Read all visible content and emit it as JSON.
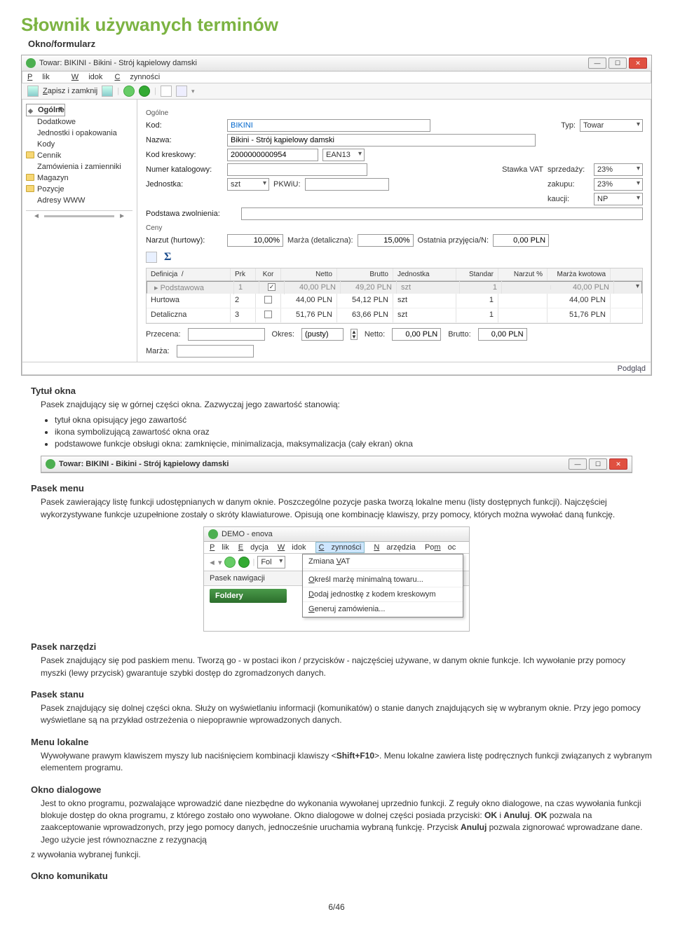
{
  "heading": "Słownik używanych terminów",
  "section_okno": "Okno/formularz",
  "win1": {
    "title": "Towar: BIKINI - Bikini - Strój kąpielowy damski",
    "menu": {
      "plik": "Plik",
      "widok": "Widok",
      "czynnosci": "Czynności"
    },
    "toolbar": {
      "save": "Zapisz i zamknij"
    },
    "sidebar": [
      "Ogólne",
      "Dodatkowe",
      "Jednostki i opakowania",
      "Kody",
      "Cennik",
      "Zamówienia i zamienniki",
      "Magazyn",
      "Pozycje",
      "Adresy WWW"
    ],
    "group_ogolne": "Ogólne",
    "labels": {
      "kod": "Kod:",
      "nazwa": "Nazwa:",
      "kodkr": "Kod kreskowy:",
      "numkat": "Numer katalogowy:",
      "jedn": "Jednostka:",
      "typ": "Typ:",
      "stawka": "Stawka VAT",
      "sprz": "sprzedaży:",
      "zak": "zakupu:",
      "kauc": "kaucji:",
      "pkwiu": "PKWiU:",
      "podstawa": "Podstawa zwolnienia:"
    },
    "vals": {
      "kod": "BIKINI",
      "nazwa": "Bikini - Strój kąpielowy damski",
      "kodkr": "2000000000954",
      "ean": "EAN13",
      "jedn": "szt",
      "typ": "Towar",
      "sprz": "23%",
      "zak": "23%",
      "kauc": "NP"
    },
    "group_ceny": "Ceny",
    "ceny": {
      "narzut_l": "Narzut (hurtowy):",
      "narzut_v": "10,00%",
      "marza_l": "Marża (detaliczna):",
      "marza_v": "15,00%",
      "ost_l": "Ostatnia przyjęcia/N:",
      "ost_v": "0,00 PLN"
    },
    "gridhead": {
      "def": "Definicja",
      "prk": "Prk",
      "kor": "Kor",
      "net": "Netto",
      "bru": "Brutto",
      "jed": "Jednostka",
      "std": "Standar",
      "nar": "Narzut %",
      "mk": "Marża kwotowa"
    },
    "gridrows": [
      {
        "def": "Podstawowa",
        "prk": "1",
        "kor": true,
        "net": "40,00 PLN",
        "bru": "49,20 PLN",
        "jed": "szt",
        "std": "1",
        "nar": "",
        "mk": "40,00 PLN",
        "sel": true
      },
      {
        "def": "Hurtowa",
        "prk": "2",
        "kor": false,
        "net": "44,00 PLN",
        "bru": "54,12 PLN",
        "jed": "szt",
        "std": "1",
        "nar": "",
        "mk": "44,00 PLN"
      },
      {
        "def": "Detaliczna",
        "prk": "3",
        "kor": false,
        "net": "51,76 PLN",
        "bru": "63,66 PLN",
        "jed": "szt",
        "std": "1",
        "nar": "",
        "mk": "51,76 PLN"
      }
    ],
    "footer": {
      "przecena": "Przecena:",
      "okres": "Okres:",
      "okres_v": "(pusty)",
      "netto": "Netto:",
      "netto_v": "0,00 PLN",
      "brutto": "Brutto:",
      "brutto_v": "0,00 PLN",
      "marza": "Marża:"
    },
    "status": "Podgląd"
  },
  "sec_tytul": {
    "h": "Tytuł okna",
    "p": "Pasek znajdujący się w górnej części okna. Zazwyczaj jego zawartość stanowią:",
    "b": [
      "tytuł okna opisujący jego zawartość",
      "ikona symbolizującą zawartość okna oraz",
      "podstawowe funkcje obsługi okna: zamknięcie, minimalizacja, maksymalizacja (cały ekran) okna"
    ]
  },
  "tb2_title": "Towar: BIKINI - Bikini - Strój kąpielowy damski",
  "sec_menu": {
    "h": "Pasek menu",
    "p": "Pasek zawierający listę funkcji udostępnianych w danym oknie. Poszczególne pozycje paska tworzą lokalne menu (listy dostępnych funkcji). Najczęściej wykorzystywane funkcje uzupełnione zostały o skróty klawiaturowe. Opisują one kombinację klawiszy, przy pomocy, których można wywołać daną funkcję."
  },
  "menuimg": {
    "title": "DEMO - enova",
    "menus": {
      "plik": "Plik",
      "edycja": "Edycja",
      "widok": "Widok",
      "czynnosci": "Czynności",
      "narzedzia": "Narzędzia",
      "pomoc": "Pomoc"
    },
    "fol": "Fol",
    "nav": "Pasek nawigacji",
    "foldery": "Foldery",
    "popup": [
      "Zmiana VAT",
      "Określ marżę minimalną towaru...",
      "Dodaj jednostkę z kodem kreskowym",
      "Generuj zamówienia..."
    ]
  },
  "sec_narz": {
    "h": "Pasek narzędzi",
    "p": "Pasek znajdujący się pod paskiem menu. Tworzą go - w postaci ikon / przycisków - najczęściej używane, w danym oknie funkcje. Ich wywołanie przy pomocy myszki (lewy przycisk) gwarantuje szybki dostęp do zgromadzonych danych."
  },
  "sec_stan": {
    "h": "Pasek stanu",
    "p": "Pasek znajdujący się dolnej części okna. Służy on wyświetlaniu informacji (komunikatów) o stanie danych znajdujących się w wybranym oknie. Przy jego pomocy wyświetlane są na przykład ostrzeżenia o niepoprawnie wprowadzonych danych."
  },
  "sec_lokalne": {
    "h": "Menu lokalne",
    "p": "Wywoływane prawym klawiszem myszy lub naciśnięciem kombinacji klawiszy <Shift+F10>. Menu lokalne zawiera listę podręcznych funkcji związanych z wybranym elementem programu."
  },
  "sec_dialog": {
    "h": "Okno dialogowe",
    "p": "Jest to okno programu, pozwalające wprowadzić dane niezbędne do wykonania wywołanej uprzednio funkcji. Z reguły okno dialogowe, na czas wywołania funkcji blokuje dostęp do okna programu, z którego zostało ono wywołane. Okno dialogowe w dolnej części posiada przyciski: OK i Anuluj. OK pozwala na zaakceptowanie wprowadzonych, przy jego pomocy danych, jednocześnie uruchamia wybraną funkcję. Przycisk Anuluj pozwala zignorować wprowadzane dane. Jego użycie jest równoznaczne z rezygnacją",
    "p2": "z wywołania wybranej funkcji."
  },
  "sec_komunikat": {
    "h": "Okno komunikatu"
  },
  "page_num": "6/46"
}
